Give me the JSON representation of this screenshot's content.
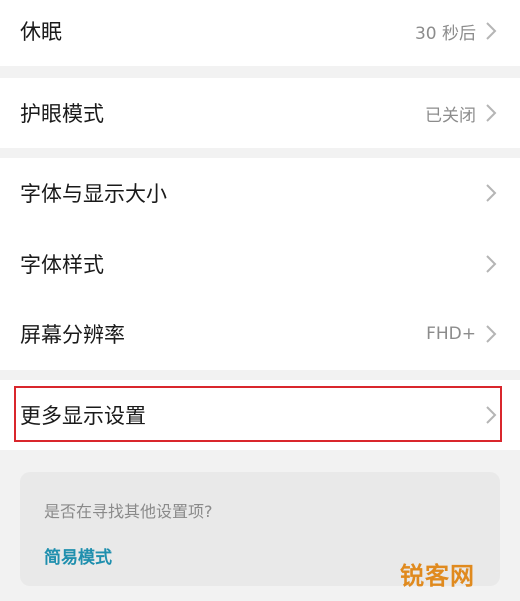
{
  "settings": {
    "sleep": {
      "label": "休眠",
      "value": "30 秒后"
    },
    "eye_care": {
      "label": "护眼模式",
      "value": "已关闭"
    },
    "font_display_size": {
      "label": "字体与显示大小"
    },
    "font_style": {
      "label": "字体样式"
    },
    "resolution": {
      "label": "屏幕分辨率",
      "value": "FHD+"
    },
    "more_display": {
      "label": "更多显示设置"
    }
  },
  "suggestion_card": {
    "question": "是否在寻找其他设置项?",
    "link_label": "简易模式"
  },
  "watermark": {
    "text": "锐客网"
  },
  "colors": {
    "background": "#f2f2f2",
    "row": "#ffffff",
    "link": "#1f8fae",
    "highlight_border": "#d9262c"
  }
}
